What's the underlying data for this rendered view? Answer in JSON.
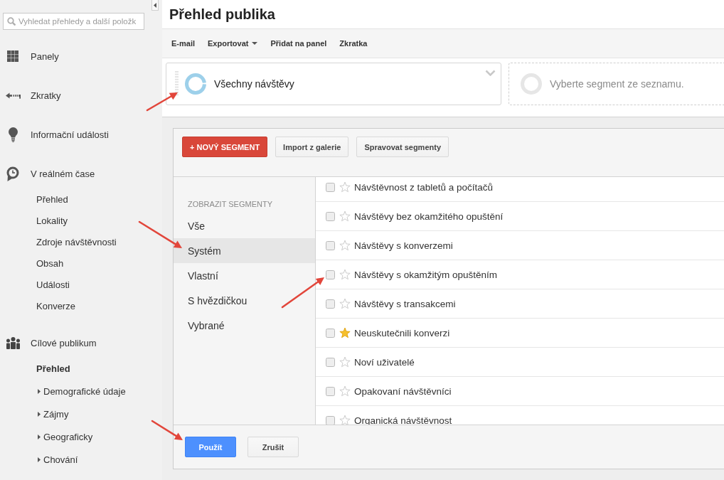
{
  "sidebar": {
    "search": {
      "placeholder": "Vyhledat přehledy a další položk"
    },
    "items": [
      {
        "label": "Panely",
        "selected": false
      },
      {
        "label": "Zkratky",
        "selected": false
      },
      {
        "label": "Informační události",
        "selected": false
      },
      {
        "label": "V reálném čase",
        "selected": false,
        "children": [
          {
            "label": "Přehled",
            "selected": false
          },
          {
            "label": "Lokality",
            "selected": false
          },
          {
            "label": "Zdroje návštěvnosti",
            "selected": false
          },
          {
            "label": "Obsah",
            "selected": false
          },
          {
            "label": "Události",
            "selected": false
          },
          {
            "label": "Konverze",
            "selected": false
          }
        ]
      },
      {
        "label": "Cílové publikum",
        "selected": false,
        "children": [
          {
            "label": "Přehled",
            "selected": true
          },
          {
            "label": "Demografické údaje",
            "selected": false,
            "expanded": false
          },
          {
            "label": "Zájmy",
            "selected": false,
            "expanded": false
          },
          {
            "label": "Geograficky",
            "selected": false,
            "expanded": false
          },
          {
            "label": "Chování",
            "selected": false,
            "expanded": false
          }
        ]
      }
    ]
  },
  "page": {
    "title": "Přehled publika"
  },
  "toolbar": [
    {
      "label": "E-mail",
      "kind": "action"
    },
    {
      "label": "Exportovat",
      "kind": "menu"
    },
    {
      "label": "Přidat na panel",
      "kind": "action"
    },
    {
      "label": "Zkratka",
      "kind": "action"
    }
  ],
  "segment_bar": [
    {
      "kind": "segment",
      "label": "Všechny návštěvy"
    },
    {
      "kind": "empty",
      "label": "Vyberte segment ze seznamu."
    }
  ],
  "segment_picker": {
    "buttons": [
      {
        "label": "+ NOVÝ SEGMENT",
        "kind": "create"
      },
      {
        "label": "Import z galerie",
        "kind": "default"
      },
      {
        "label": "Spravovat segmenty",
        "kind": "default"
      }
    ],
    "filter": {
      "heading": "ZOBRAZIT SEGMENTY",
      "items": [
        {
          "label": "Vše",
          "selected": false
        },
        {
          "label": "Systém",
          "selected": true
        },
        {
          "label": "Vlastní",
          "selected": false
        },
        {
          "label": "S hvězdičkou",
          "selected": false
        },
        {
          "label": "Vybrané",
          "selected": false
        }
      ]
    },
    "segments": [
      {
        "label": "Návštěvnost z tabletů a počítačů",
        "checked": false,
        "starred": false
      },
      {
        "label": "Návštěvy bez okamžitého opuštění",
        "checked": false,
        "starred": false
      },
      {
        "label": "Návštěvy s konverzemi",
        "checked": false,
        "starred": false
      },
      {
        "label": "Návštěvy s okamžitým opuštěním",
        "checked": false,
        "starred": false
      },
      {
        "label": "Návštěvy s transakcemi",
        "checked": false,
        "starred": false
      },
      {
        "label": "Neuskutečnili konverzi",
        "checked": false,
        "starred": true
      },
      {
        "label": "Noví uživatelé",
        "checked": false,
        "starred": false
      },
      {
        "label": "Opakovaní návštěvníci",
        "checked": false,
        "starred": false
      },
      {
        "label": "Organická návštěvnost",
        "checked": false,
        "starred": false
      }
    ],
    "actions": [
      {
        "label": "Použít",
        "kind": "primary"
      },
      {
        "label": "Zrušit",
        "kind": "default"
      }
    ]
  }
}
